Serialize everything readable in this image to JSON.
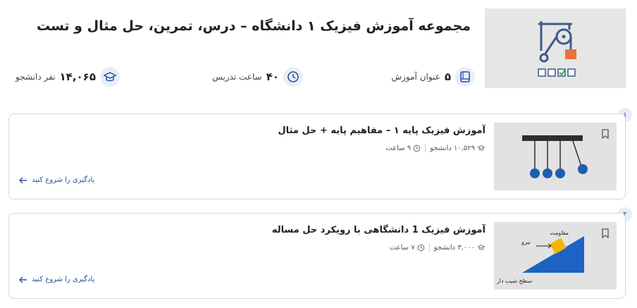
{
  "header": {
    "title": "مجموعه آموزش فیزیک ۱ دانشگاه – درس، تمرین، حل مثال و تست",
    "thumbnail_icon": "physics-pulley-icon"
  },
  "stats": {
    "courses": {
      "value": "۵",
      "label": "عنوان آموزش",
      "icon": "book-icon"
    },
    "hours": {
      "value": "۴۰",
      "label": "ساعت تدریس",
      "icon": "clock-icon"
    },
    "students": {
      "value": "۱۴,۰۶۵",
      "label": "نفر دانشجو",
      "icon": "graduation-cap-icon"
    }
  },
  "courses": [
    {
      "index": "۱",
      "title": "آموزش فیزیک پایه ۱ – مفاهیم پایه + حل مثال",
      "students": "۱۰,۵۲۹ دانشجو",
      "hours": "۹ ساعت",
      "start": "یادگیری را شروع کنید",
      "thumbnail": "newtons-cradle"
    },
    {
      "index": "۲",
      "title": "آموزش فیزیک 1 دانشگاهی با رویکرد حل مساله",
      "students": "۳,۰۰۰ دانشجو",
      "hours": "۷ ساعت",
      "start": "یادگیری را شروع کنید",
      "thumbnail": "inclined-plane",
      "thumb_labels": {
        "resistance": "مقاومت",
        "force": "نیرو",
        "surface": "سطح شیب دار"
      }
    }
  ],
  "colors": {
    "accent": "#2c4f9e",
    "badge_bg": "#e7ecf7",
    "ball": "#1f5fae",
    "block": "#f4b400",
    "slope": "#1d63c4"
  }
}
